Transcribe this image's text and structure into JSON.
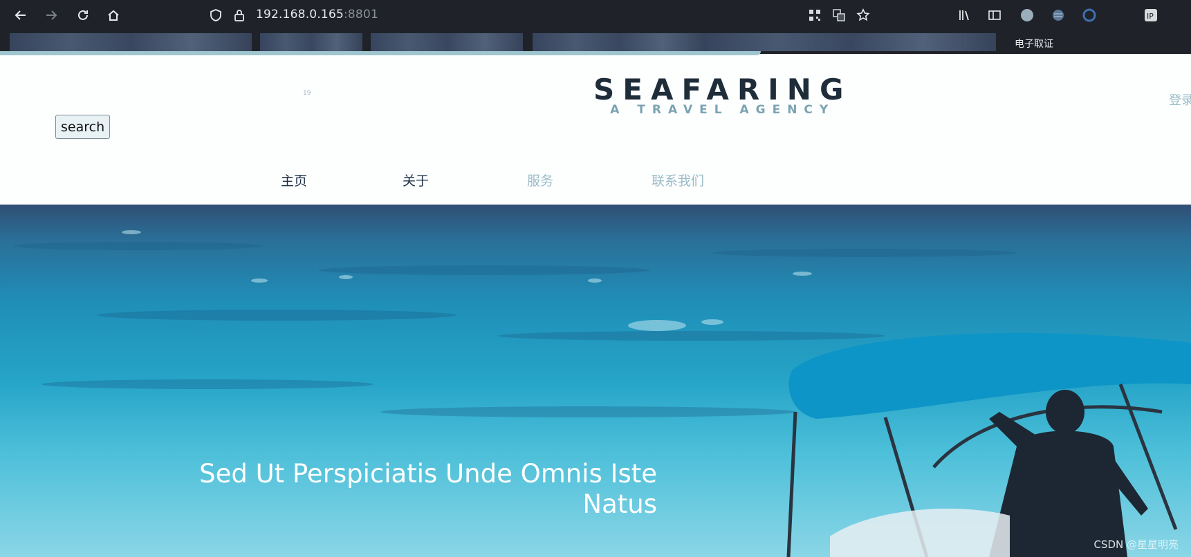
{
  "browser": {
    "url_host": "192.168.0.165",
    "url_port": ":8801",
    "icons": [
      "back-icon",
      "forward-icon",
      "reload-icon",
      "home-icon",
      "shield-icon",
      "lock-icon",
      "qr-code-icon",
      "translate-icon",
      "star-icon",
      "library-icon",
      "sidebar-icon",
      "profile-icon",
      "globe-icon",
      "extension-icon",
      "ip-icon"
    ],
    "bookmark_label": "电子取证"
  },
  "header": {
    "search_label": "search",
    "search_hint": "19",
    "logo_title": "SEAFARING",
    "logo_subtitle": "A TRAVEL AGENCY",
    "login_label": "登录"
  },
  "nav": {
    "home": "主页",
    "about": "关于",
    "service": "服务",
    "contact": "联系我们"
  },
  "hero": {
    "title_line1": "Sed Ut Perspiciatis Unde Omnis Iste",
    "title_line2": "Natus",
    "watermark": "CSDN @星星明亮"
  },
  "colors": {
    "chrome": "#1f2329",
    "logo_dark": "#1f2d3a",
    "logo_accent": "#7aa3b2",
    "nav_active": "#1f3347",
    "nav_muted": "#9bbcc8",
    "sea_deep": "#2f4f74",
    "sea_mid": "#1f8fb8",
    "sea_light": "#8ad6e6"
  }
}
